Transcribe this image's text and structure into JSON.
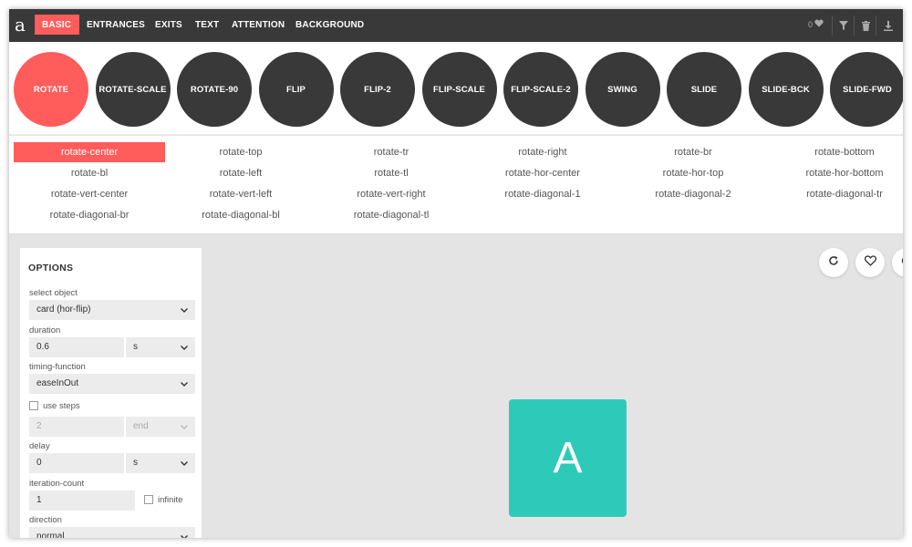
{
  "app": {
    "logo": "a"
  },
  "nav": {
    "tabs": [
      "BASIC",
      "ENTRANCES",
      "EXITS",
      "TEXT",
      "ATTENTION",
      "BACKGROUND"
    ],
    "active_tab": "BASIC",
    "favorite_count": "0"
  },
  "icons": {
    "heart": "heart-icon",
    "filter": "filter-icon",
    "trash": "trash-icon",
    "download": "download-icon",
    "refresh": "refresh-icon",
    "chevron": "chevron-down-icon"
  },
  "categories": [
    "ROTATE",
    "ROTATE-SCALE",
    "ROTATE-90",
    "FLIP",
    "FLIP-2",
    "FLIP-SCALE",
    "FLIP-SCALE-2",
    "SWING",
    "SLIDE",
    "SLIDE-BCK",
    "SLIDE-FWD"
  ],
  "active_category": "ROTATE",
  "variants": [
    "rotate-center",
    "rotate-top",
    "rotate-tr",
    "rotate-right",
    "rotate-br",
    "rotate-bottom",
    "rotate-bl",
    "rotate-left",
    "rotate-tl",
    "rotate-hor-center",
    "rotate-hor-top",
    "rotate-hor-bottom",
    "rotate-vert-center",
    "rotate-vert-left",
    "rotate-vert-right",
    "rotate-diagonal-1",
    "rotate-diagonal-2",
    "rotate-diagonal-tr",
    "rotate-diagonal-br",
    "rotate-diagonal-bl",
    "rotate-diagonal-tl"
  ],
  "active_variant": "rotate-center",
  "options": {
    "title": "OPTIONS",
    "select_object_label": "select object",
    "select_object_value": "card (hor-flip)",
    "duration_label": "duration",
    "duration_value": "0.6",
    "duration_unit": "s",
    "timing_label": "timing-function",
    "timing_value": "easeInOut",
    "use_steps_label": "use steps",
    "steps_value": "2",
    "steps_position": "end",
    "delay_label": "delay",
    "delay_value": "0",
    "delay_unit": "s",
    "iteration_label": "iteration-count",
    "iteration_value": "1",
    "infinite_label": "infinite",
    "direction_label": "direction",
    "direction_value": "normal"
  },
  "colors": {
    "accent": "#ff5c5c",
    "dark": "#393939",
    "card": "#2ecab9",
    "canvas": "#e4e4e4"
  },
  "preview": {
    "card_letter": "A"
  }
}
